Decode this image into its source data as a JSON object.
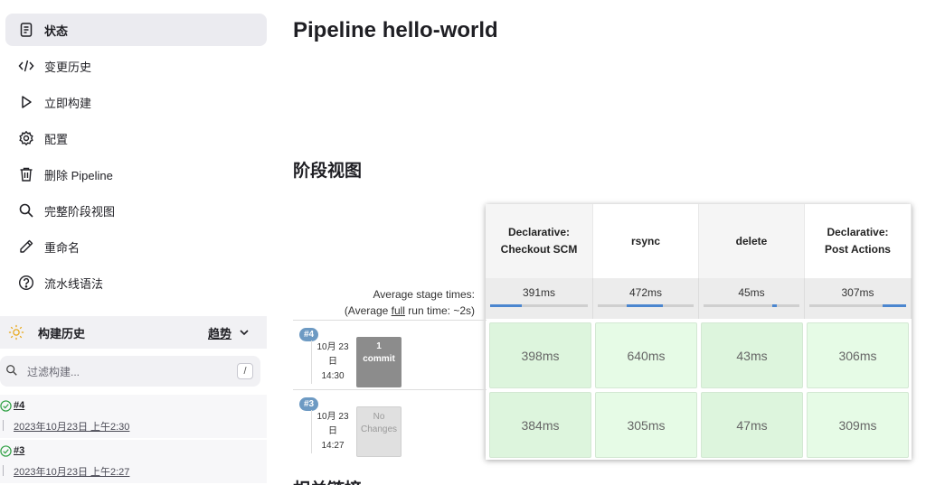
{
  "sidebar": {
    "items": [
      {
        "label": "状态",
        "icon": "document-icon"
      },
      {
        "label": "变更历史",
        "icon": "code-icon"
      },
      {
        "label": "立即构建",
        "icon": "play-icon"
      },
      {
        "label": "配置",
        "icon": "gear-icon"
      },
      {
        "label": "删除 Pipeline",
        "icon": "trash-icon"
      },
      {
        "label": "完整阶段视图",
        "icon": "search-icon"
      },
      {
        "label": "重命名",
        "icon": "pencil-icon"
      },
      {
        "label": "流水线语法",
        "icon": "help-icon"
      }
    ],
    "build_history": {
      "title": "构建历史",
      "trend_label": "趋势",
      "filter_placeholder": "过滤构建...",
      "filter_shortcut": "/",
      "builds": [
        {
          "number": "#4",
          "date": "2023年10月23日 上午2:30"
        },
        {
          "number": "#3",
          "date": "2023年10月23日 上午2:27"
        }
      ]
    }
  },
  "main": {
    "title": "Pipeline hello-world",
    "stage_view_title": "阶段视图",
    "related_links_title": "相关链接",
    "avg_label": "Average stage times:",
    "avg_full_prefix": "(Average ",
    "avg_full_link": "full",
    "avg_full_suffix": " run time: ~2s)",
    "stages": [
      {
        "name": "Declarative: Checkout SCM",
        "avg": "391ms"
      },
      {
        "name": "rsync",
        "avg": "472ms"
      },
      {
        "name": "delete",
        "avg": "45ms"
      },
      {
        "name": "Declarative: Post Actions",
        "avg": "307ms"
      }
    ],
    "runs": [
      {
        "badge": "#4",
        "date_line1": "10月 23",
        "date_line2": "日",
        "time": "14:30",
        "changes_line1": "1",
        "changes_line2": "commit",
        "durations": [
          "398ms",
          "640ms",
          "43ms",
          "306ms"
        ]
      },
      {
        "badge": "#3",
        "date_line1": "10月 23",
        "date_line2": "日",
        "time": "14:27",
        "changes_line1": "No",
        "changes_line2": "Changes",
        "durations": [
          "384ms",
          "305ms",
          "47ms",
          "309ms"
        ]
      }
    ]
  },
  "colors": {
    "accent": "#4b86cf",
    "success": "#2ea043",
    "cell_green": "#ddf5dd"
  }
}
